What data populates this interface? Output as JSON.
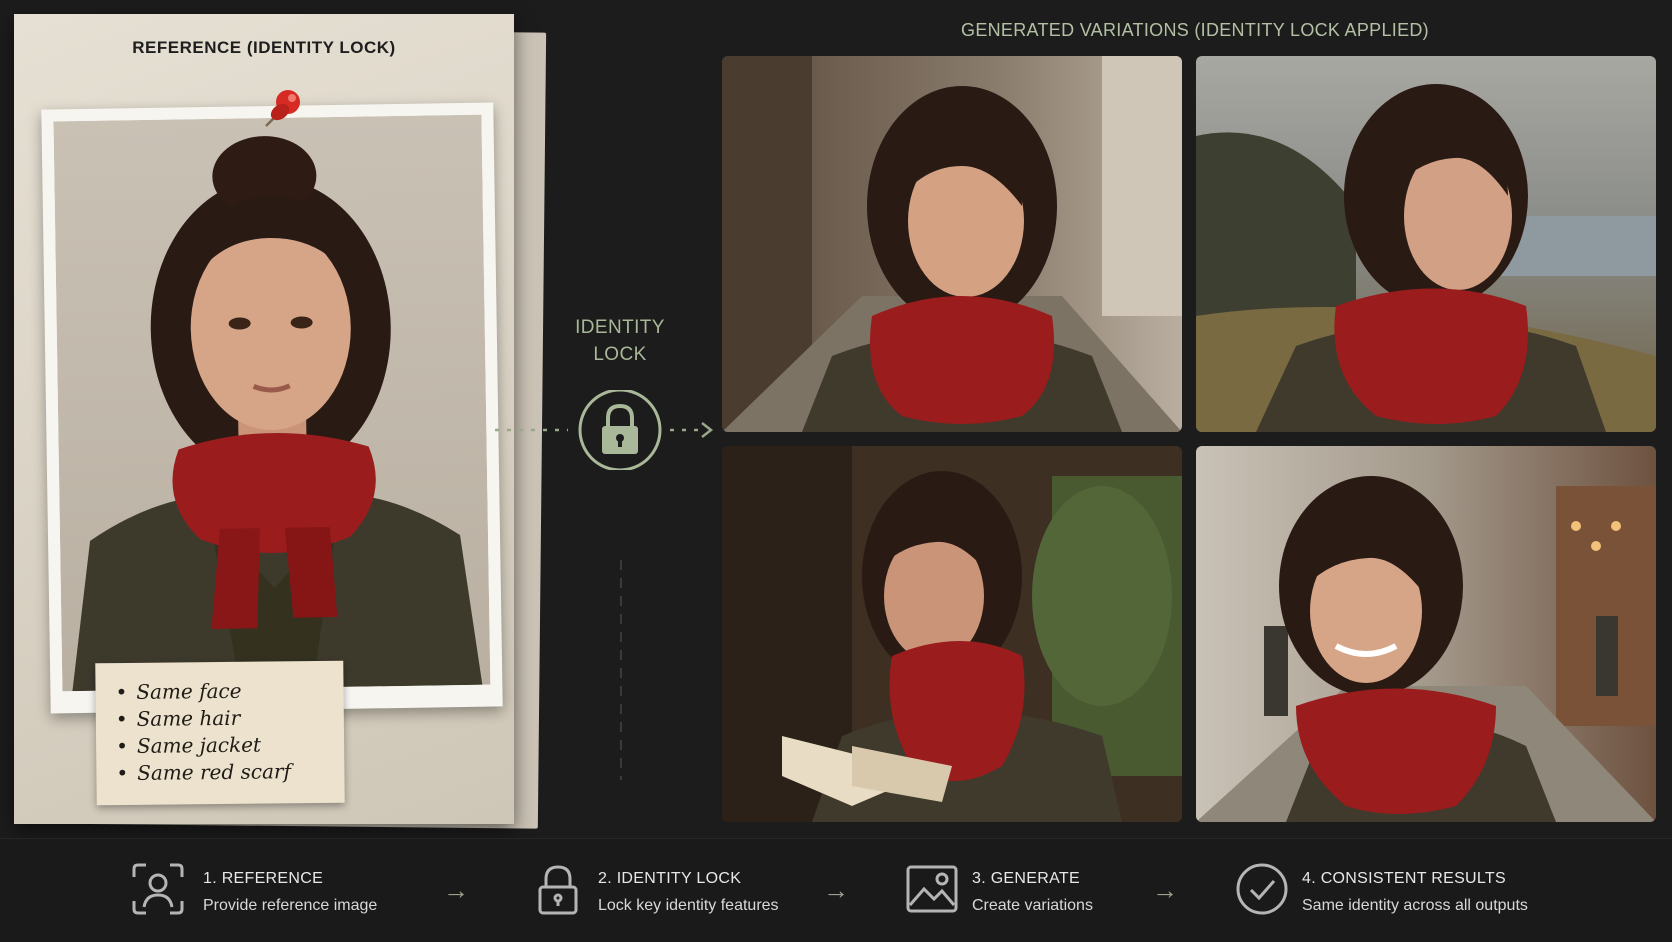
{
  "reference": {
    "title": "REFERENCE (IDENTITY LOCK)",
    "notes": [
      "Same face",
      "Same hair",
      "Same jacket",
      "Same red scarf"
    ]
  },
  "lock": {
    "label_line1": "IDENTITY",
    "label_line2": "LOCK",
    "icon": "padlock-icon"
  },
  "variations": {
    "title": "GENERATED VARIATIONS (IDENTITY LOCK APPLIED)",
    "images": [
      {
        "scene": "street-portrait"
      },
      {
        "scene": "coastal-cliff"
      },
      {
        "scene": "reading-book"
      },
      {
        "scene": "smiling-street"
      }
    ]
  },
  "steps": [
    {
      "title": "1. REFERENCE",
      "desc": "Provide reference image",
      "icon": "face-scan-icon"
    },
    {
      "title": "2. IDENTITY LOCK",
      "desc": "Lock key identity features",
      "icon": "padlock-icon"
    },
    {
      "title": "3. GENERATE",
      "desc": "Create variations",
      "icon": "image-icon"
    },
    {
      "title": "4. CONSISTENT RESULTS",
      "desc": "Same identity across all outputs",
      "icon": "check-circle-icon"
    }
  ],
  "colors": {
    "accent_green": "#a8b898",
    "scarf_red": "#9a1c1c",
    "jacket": "#3f3a2c",
    "background": "#1c1c1c"
  }
}
